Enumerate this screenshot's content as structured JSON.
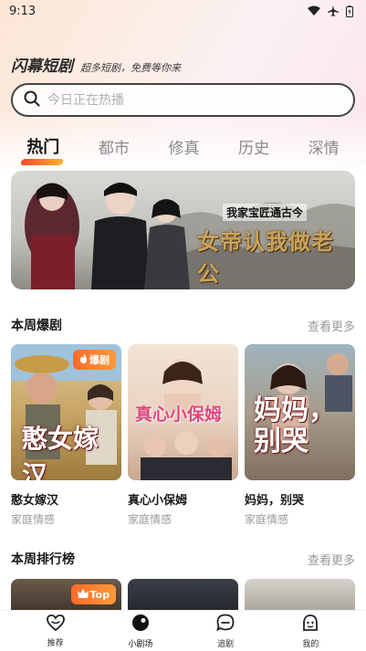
{
  "status_bar": {
    "time": "9:13"
  },
  "brand": {
    "name": "闪幕短剧",
    "slogan": "超多短剧，免费等你来"
  },
  "search": {
    "placeholder": "今日正在热播"
  },
  "tabs": [
    {
      "label": "热门",
      "active": true
    },
    {
      "label": "都市",
      "active": false
    },
    {
      "label": "修真",
      "active": false
    },
    {
      "label": "历史",
      "active": false
    },
    {
      "label": "深情",
      "active": false
    }
  ],
  "banner": {
    "tag": "我家宝匠通古今",
    "title": "女帝认我做老公"
  },
  "sections": {
    "weekly_hits": {
      "title": "本周爆剧",
      "more": "查看更多"
    },
    "weekly_rank": {
      "title": "本周排行榜",
      "more": "查看更多"
    }
  },
  "weekly_hits_cards": [
    {
      "title": "憨女嫁汉",
      "genre": "家庭情感",
      "poster_text": "憨女嫁汉",
      "badge": "爆剧"
    },
    {
      "title": "真心小保姆",
      "genre": "家庭情感",
      "poster_text": "真心小保姆",
      "badge": ""
    },
    {
      "title": "妈妈，别哭",
      "genre": "家庭情感",
      "poster_text": "妈妈，别哭",
      "badge": ""
    }
  ],
  "rank_badge": "Top",
  "bottom_nav": [
    {
      "label": "推荐",
      "icon": "heart-icon",
      "active": false
    },
    {
      "label": "小剧场",
      "icon": "theater-icon",
      "active": true
    },
    {
      "label": "追剧",
      "icon": "chat-icon",
      "active": false
    },
    {
      "label": "我的",
      "icon": "profile-icon",
      "active": false
    }
  ],
  "colors": {
    "accent_start": "#ff4b2b",
    "accent_end": "#ffb02e",
    "muted": "#9a9a9a"
  }
}
